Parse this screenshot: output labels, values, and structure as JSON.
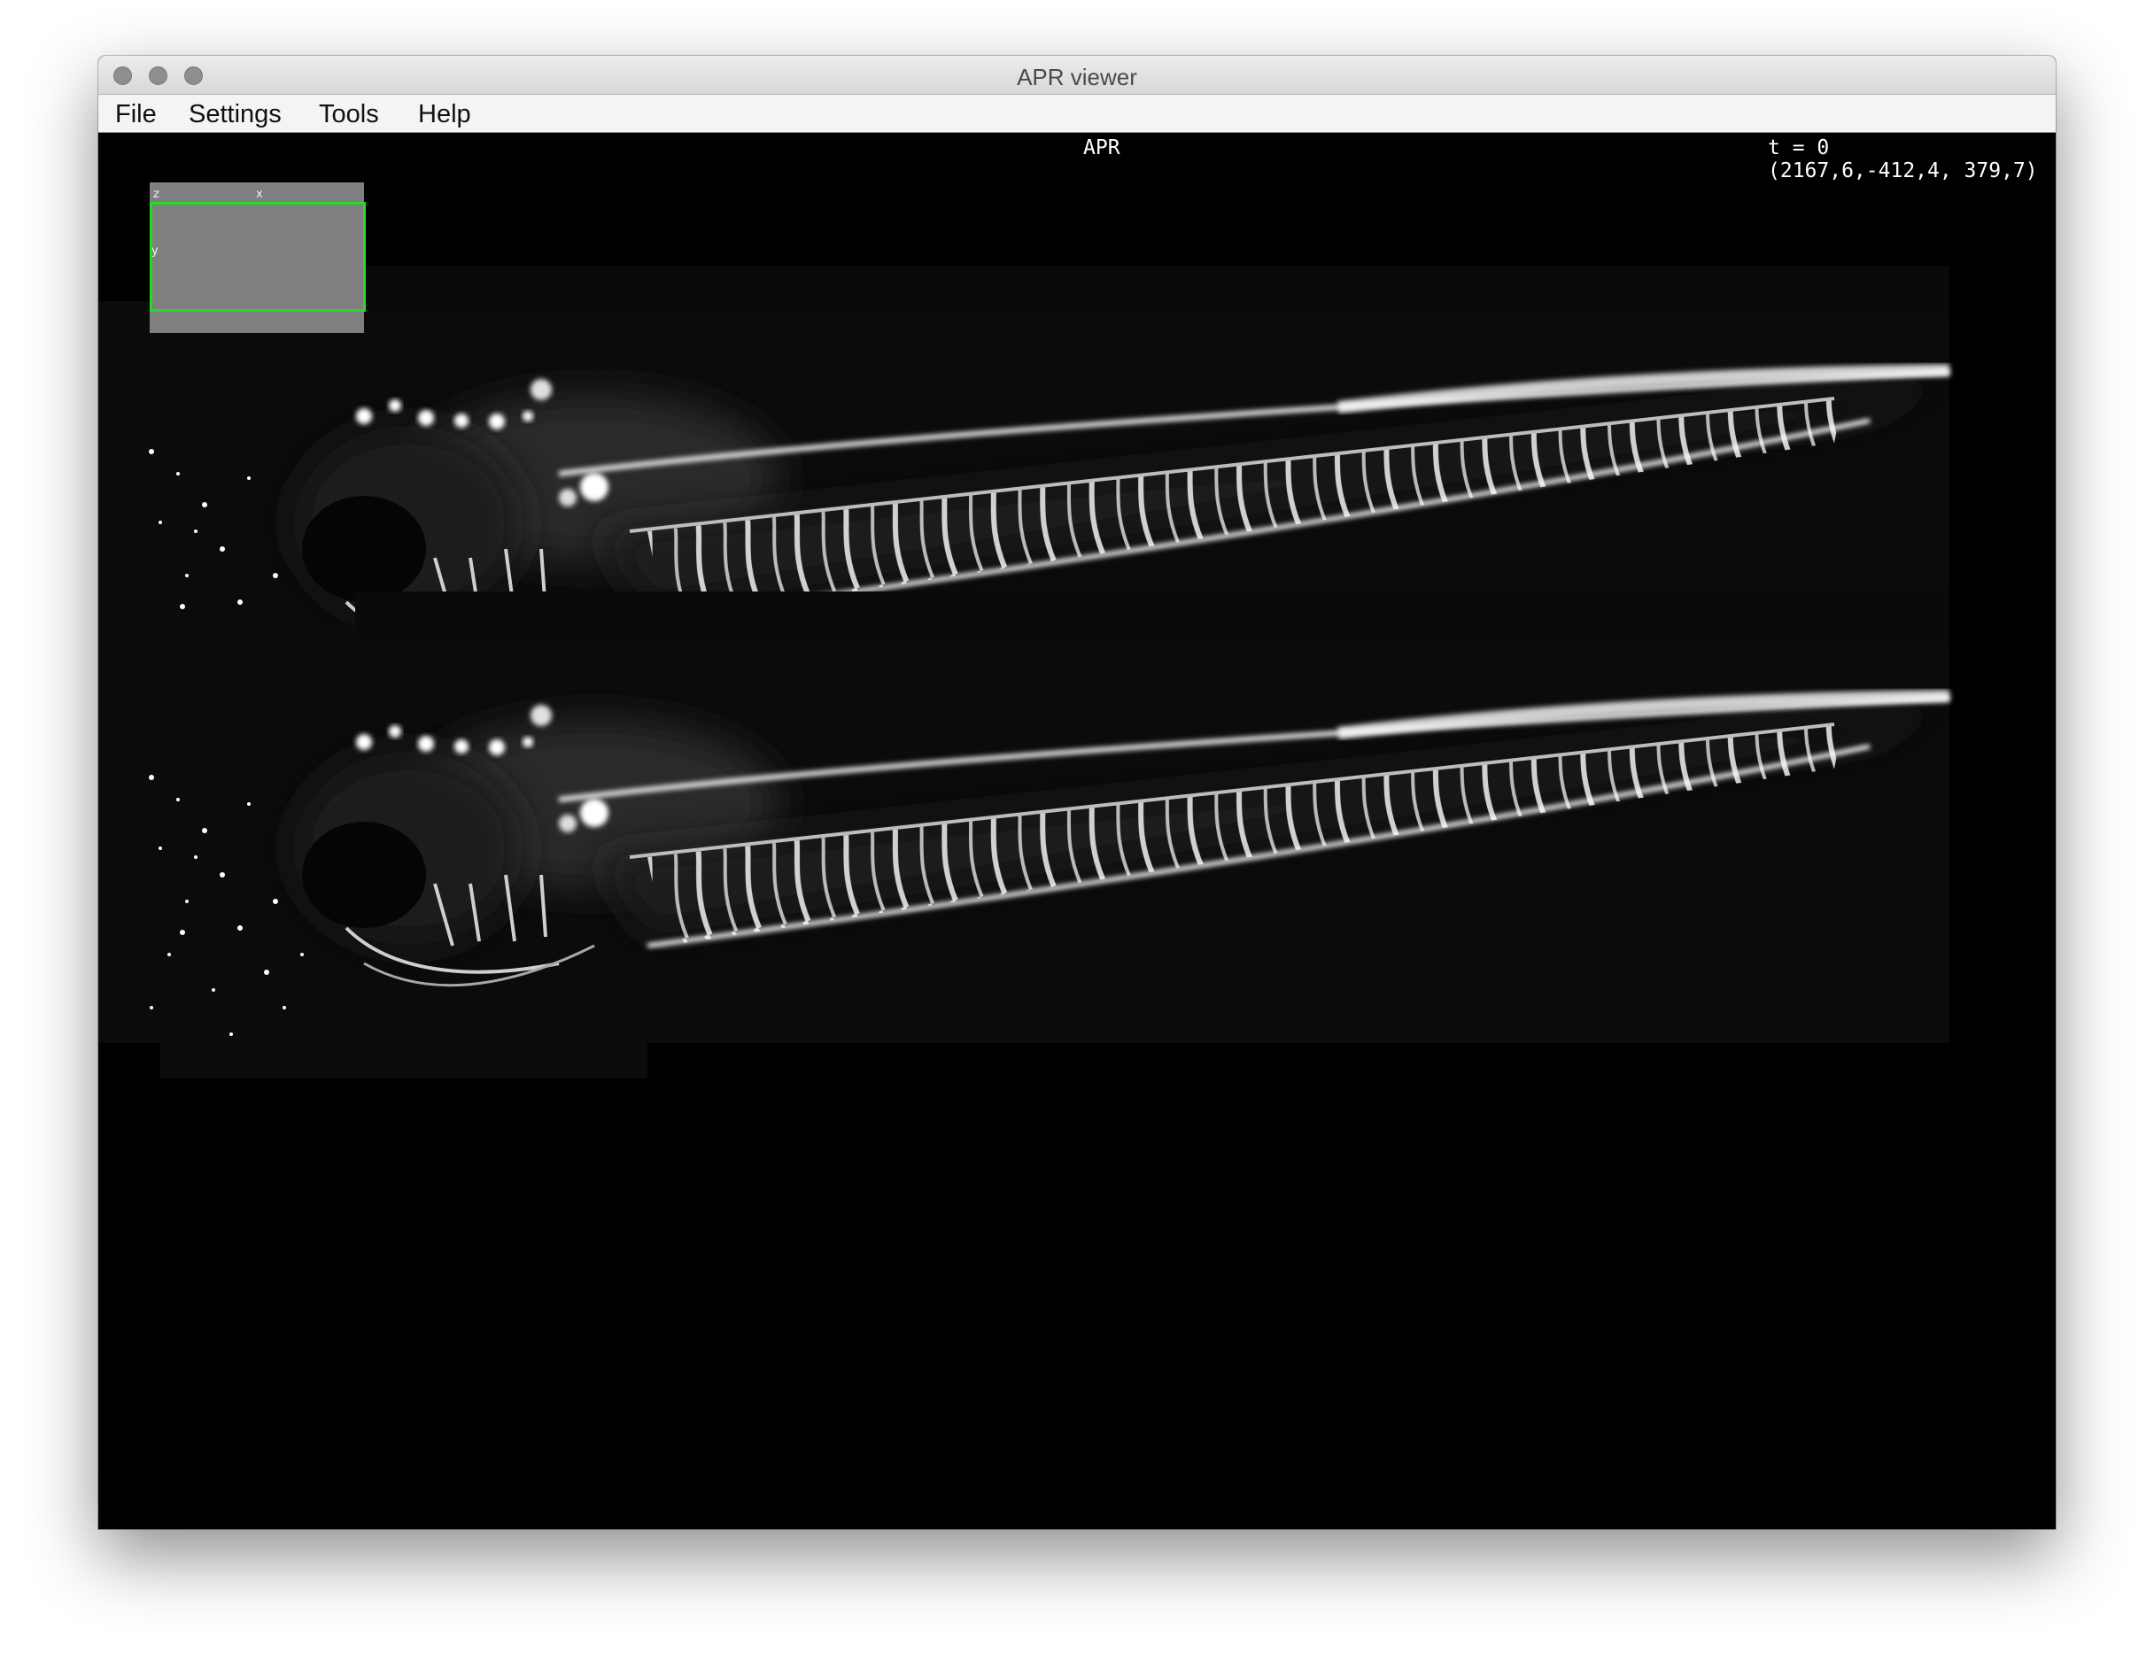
{
  "window": {
    "title": "APR viewer",
    "traffic_light_color": "#8e8e8e"
  },
  "menu": {
    "items": [
      "File",
      "Settings",
      "Tools",
      "Help"
    ]
  },
  "viewer": {
    "renderer_label": "APR",
    "time_label": "t = 0",
    "camera_label": "(2167,6,-412,4, 379,7)",
    "overview": {
      "axis_z": "z",
      "axis_x": "x",
      "axis_y": "y",
      "frame_color": "#22dd22",
      "panel_color": "#7f7f7f"
    },
    "content": "two stacked grayscale volume renderings of a zebrafish larva vasculature"
  }
}
